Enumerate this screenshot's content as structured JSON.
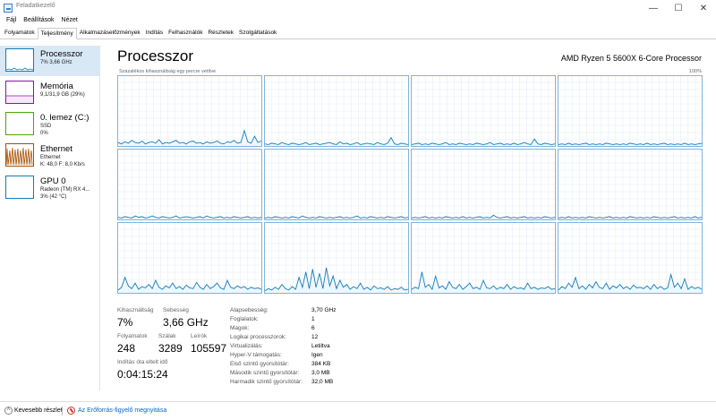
{
  "window": {
    "title": "Feladatkezelő",
    "minimize": "—",
    "maximize": "☐",
    "close": "✕"
  },
  "menu": [
    "Fájl",
    "Beállítások",
    "Nézet"
  ],
  "tabs": [
    {
      "label": "Folyamatok",
      "active": false
    },
    {
      "label": "Teljesítmény",
      "active": true
    },
    {
      "label": "Alkalmazáselőzmények",
      "active": false
    },
    {
      "label": "Indítás",
      "active": false
    },
    {
      "label": "Felhasználók",
      "active": false
    },
    {
      "label": "Részletek",
      "active": false
    },
    {
      "label": "Szolgáltatások",
      "active": false
    }
  ],
  "sidebar": {
    "items": [
      {
        "name": "Processzor",
        "sub1": "7% 3,66 GHz",
        "sub2": "",
        "color": "#117dbb",
        "selected": true
      },
      {
        "name": "Memória",
        "sub1": "9,1/31,9 GB (29%)",
        "sub2": "",
        "color": "#8b12ae",
        "selected": false
      },
      {
        "name": "0. lemez (C:)",
        "sub1": "SSD",
        "sub2": "0%",
        "color": "#4da60c",
        "selected": false
      },
      {
        "name": "Ethernet",
        "sub1": "Ethernet",
        "sub2": "K: 48,0  F: 8,0 Kb/s",
        "color": "#a74f01",
        "selected": false
      },
      {
        "name": "GPU 0",
        "sub1": "Radeon (TM) RX 4...",
        "sub2": "3% (42 °C)",
        "color": "#117dbb",
        "selected": false
      }
    ]
  },
  "main": {
    "title": "Processzor",
    "cpu_name": "AMD Ryzen 5 5600X 6-Core Processor",
    "graph_label": "Százalékos kihasználtság egy percre vetítve",
    "graph_max": "100%",
    "graph_color": "#117dbb",
    "graph_fill": "#f1f6fa",
    "graph_border": "#7fb4dd"
  },
  "chart_data": {
    "type": "area",
    "title": "",
    "ylim": [
      0,
      100
    ],
    "series": [
      {
        "values": [
          5,
          3,
          6,
          4,
          8,
          5,
          4,
          7,
          3,
          5,
          6,
          4,
          9,
          3,
          5,
          4,
          6,
          8,
          4,
          5,
          3,
          6,
          7,
          4,
          5,
          3,
          6,
          4,
          5,
          7,
          4,
          3,
          6,
          5,
          8,
          4,
          5,
          22,
          6,
          4,
          14,
          5,
          7
        ]
      },
      {
        "values": [
          3,
          2,
          4,
          3,
          2,
          5,
          3,
          2,
          4,
          3,
          2,
          3,
          5,
          2,
          3,
          4,
          2,
          3,
          4,
          5,
          3,
          2,
          6,
          3,
          4,
          2,
          3,
          5,
          2,
          3,
          4,
          3,
          2,
          5,
          3,
          2,
          4,
          12,
          3,
          2,
          4,
          3,
          2
        ]
      },
      {
        "values": [
          2,
          3,
          4,
          2,
          3,
          2,
          4,
          3,
          2,
          3,
          5,
          2,
          3,
          2,
          4,
          3,
          2,
          3,
          2,
          4,
          3,
          2,
          3,
          5,
          2,
          3,
          4,
          2,
          3,
          2,
          4,
          2,
          3,
          5,
          3,
          2,
          10,
          3,
          2,
          4,
          3,
          2,
          3
        ]
      },
      {
        "values": [
          2,
          3,
          2,
          4,
          2,
          3,
          2,
          3,
          4,
          2,
          3,
          2,
          3,
          2,
          4,
          3,
          2,
          3,
          2,
          3,
          2,
          4,
          3,
          2,
          3,
          2,
          4,
          2,
          3,
          2,
          3,
          4,
          2,
          3,
          2,
          3,
          2,
          4,
          2,
          3,
          2,
          3,
          4
        ]
      },
      {
        "values": [
          3,
          2,
          4,
          3,
          2,
          5,
          3,
          4,
          2,
          3,
          5,
          3,
          2,
          4,
          3,
          2,
          3,
          5,
          2,
          3,
          4,
          3,
          2,
          3,
          4,
          2,
          5,
          3,
          2,
          3,
          4,
          2,
          3,
          2,
          4,
          3,
          2,
          3,
          4,
          2,
          3,
          2,
          3
        ]
      },
      {
        "values": [
          2,
          3,
          2,
          4,
          3,
          2,
          3,
          2,
          4,
          3,
          2,
          5,
          3,
          2,
          3,
          2,
          4,
          3,
          2,
          3,
          2,
          3,
          4,
          2,
          3,
          2,
          3,
          5,
          2,
          3,
          2,
          4,
          3,
          2,
          3,
          2,
          4,
          3,
          2,
          3,
          4,
          2,
          3
        ]
      },
      {
        "values": [
          2,
          3,
          2,
          3,
          4,
          2,
          3,
          2,
          3,
          2,
          4,
          3,
          2,
          3,
          2,
          4,
          2,
          3,
          2,
          3,
          4,
          2,
          3,
          2,
          6,
          3,
          2,
          3,
          4,
          2,
          3,
          2,
          3,
          4,
          2,
          3,
          2,
          3,
          2,
          4,
          3,
          2,
          3
        ]
      },
      {
        "values": [
          2,
          3,
          2,
          4,
          2,
          3,
          2,
          3,
          2,
          4,
          3,
          2,
          3,
          2,
          3,
          4,
          2,
          3,
          2,
          3,
          2,
          4,
          3,
          2,
          3,
          2,
          3,
          2,
          4,
          3,
          2,
          3,
          2,
          3,
          4,
          2,
          3,
          2,
          3,
          2,
          4,
          2,
          3
        ]
      },
      {
        "values": [
          4,
          8,
          22,
          10,
          6,
          14,
          5,
          9,
          7,
          12,
          6,
          18,
          8,
          5,
          10,
          7,
          14,
          6,
          9,
          5,
          11,
          7,
          6,
          15,
          8,
          5,
          12,
          6,
          9,
          14,
          7,
          5,
          18,
          8,
          6,
          10,
          7,
          9,
          5,
          8,
          6,
          7,
          5
        ]
      },
      {
        "values": [
          3,
          6,
          4,
          8,
          5,
          12,
          6,
          4,
          9,
          5,
          22,
          8,
          30,
          6,
          34,
          8,
          28,
          6,
          36,
          10,
          24,
          6,
          18,
          8,
          12,
          5,
          9,
          6,
          14,
          5,
          8,
          4,
          10,
          6,
          7,
          5,
          9,
          4,
          6,
          5,
          8,
          4,
          5
        ]
      },
      {
        "values": [
          5,
          8,
          6,
          30,
          8,
          12,
          5,
          24,
          7,
          10,
          5,
          16,
          8,
          6,
          12,
          5,
          9,
          14,
          6,
          8,
          5,
          18,
          7,
          6,
          10,
          5,
          8,
          6,
          12,
          5,
          9,
          6,
          7,
          5,
          14,
          6,
          8,
          5,
          7,
          6,
          9,
          5,
          6
        ]
      },
      {
        "values": [
          4,
          9,
          6,
          14,
          8,
          22,
          6,
          10,
          5,
          12,
          7,
          16,
          8,
          6,
          14,
          5,
          10,
          7,
          12,
          6,
          9,
          5,
          11,
          7,
          8,
          6,
          10,
          5,
          12,
          6,
          9,
          5,
          7,
          26,
          8,
          14,
          6,
          20,
          5,
          9,
          6,
          8,
          5
        ]
      }
    ]
  },
  "stats": {
    "util_label": "Kihasználtság",
    "util_value": "7%",
    "speed_label": "Sebesség",
    "speed_value": "3,66 GHz",
    "proc_label": "Folyamatok",
    "proc_value": "248",
    "threads_label": "Szálak",
    "threads_value": "3289",
    "handles_label": "Leírók",
    "handles_value": "105597",
    "uptime_label": "Indítás óta eltelt idő",
    "uptime_value": "0:04:15:24"
  },
  "info": [
    {
      "label": "Alapsebesség:",
      "value": "3,70 GHz"
    },
    {
      "label": "Foglalatok:",
      "value": "1"
    },
    {
      "label": "Magok:",
      "value": "6"
    },
    {
      "label": "Logikai processzorok:",
      "value": "12"
    },
    {
      "label": "Virtualizálás:",
      "value": "Letiltva"
    },
    {
      "label": "Hyper-V támogatás:",
      "value": "Igen"
    },
    {
      "label": "Első szintű gyorsítótár:",
      "value": "384 KB"
    },
    {
      "label": "Második szintű gyorsítótár:",
      "value": "3,0 MB"
    },
    {
      "label": "Harmadik szintű gyorsítótár:",
      "value": "32,0 MB"
    }
  ],
  "footer": {
    "fewer_details": "Kevesebb részlet",
    "resource_monitor": "Az Erőforrás-figyelő megnyitása"
  }
}
